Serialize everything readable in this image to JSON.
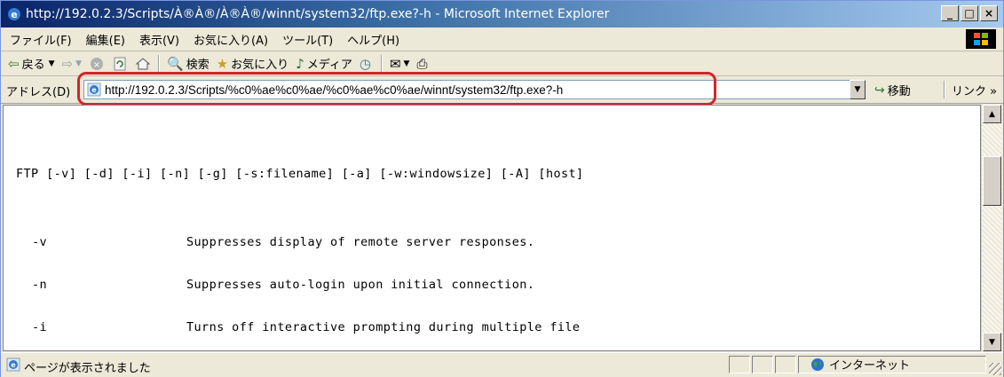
{
  "window": {
    "title": "http://192.0.2.3/Scripts/À®À®/À®À®/winnt/system32/ftp.exe?-h - Microsoft Internet Explorer"
  },
  "title_buttons": {
    "minimize": "_",
    "maximize": "□",
    "close": "×"
  },
  "menu": [
    "ファイル(F)",
    "編集(E)",
    "表示(V)",
    "お気に入り(A)",
    "ツール(T)",
    "ヘルプ(H)"
  ],
  "toolbar": {
    "back": "戻る",
    "search": "検索",
    "favorites": "お気に入り",
    "media": "メディア"
  },
  "address": {
    "label": "アドレス(D)",
    "url": "http://192.0.2.3/Scripts/%c0%ae%c0%ae/%c0%ae%c0%ae/winnt/system32/ftp.exe?-h",
    "go": "移動",
    "links": "リンク »"
  },
  "content": {
    "usage": "FTP [-v] [-d] [-i] [-n] [-g] [-s:filename] [-a] [-w:windowsize] [-A] [host]",
    "options": [
      {
        "flag": "-v",
        "desc": "Suppresses display of remote server responses."
      },
      {
        "flag": "-n",
        "desc": "Suppresses auto-login upon initial connection."
      },
      {
        "flag": "-i",
        "desc": "Turns off interactive prompting during multiple file"
      }
    ]
  },
  "status": {
    "text": "ページが表示されました",
    "zone": "インターネット"
  },
  "colors": {
    "highlight_border": "#d0262b",
    "titlebar_start": "#0a246a",
    "titlebar_end": "#a6caf0"
  }
}
